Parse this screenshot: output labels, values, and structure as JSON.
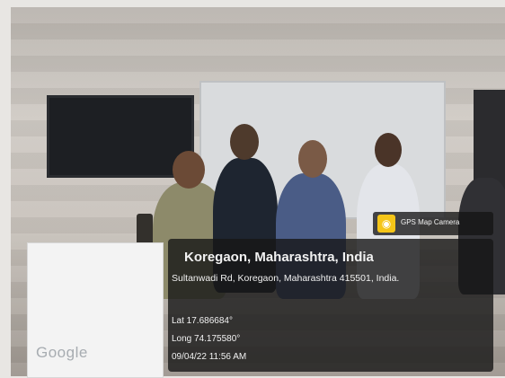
{
  "overlay": {
    "app_badge": "GPS Map Camera",
    "location_title": "Koregaon, Maharashtra, India",
    "address": "Sultanwadi Rd, Koregaon, Maharashtra 415501, India.",
    "latitude": "Lat 17.686684°",
    "longitude": "Long 74.175580°",
    "datetime": "09/04/22 11:56 AM"
  },
  "map_thumbnail": {
    "brand": "Google"
  }
}
